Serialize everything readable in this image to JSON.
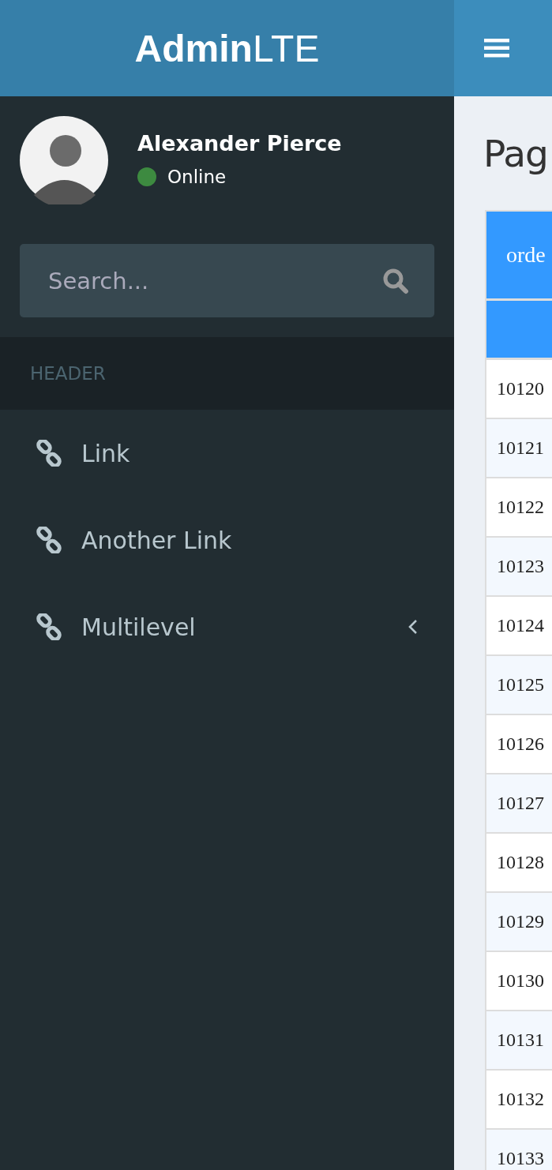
{
  "logo": "**Admin**LTE",
  "user": {
    "name": "Alexander Pierce",
    "status": "Online",
    "online": true
  },
  "search": {
    "placeholder": "Search..."
  },
  "menu_header": "HEADER",
  "menu": [
    {
      "label": "Link",
      "kind": "link"
    },
    {
      "label": "Another Link",
      "kind": "link"
    },
    {
      "label": "Multilevel",
      "kind": "tree"
    }
  ],
  "page_title": "Pag",
  "table": {
    "columns": [
      "orde"
    ],
    "rows": [
      "10120",
      "10121",
      "10122",
      "10123",
      "10124",
      "10125",
      "10126",
      "10127",
      "10128",
      "10129",
      "10130",
      "10131",
      "10132",
      "10133"
    ]
  }
}
